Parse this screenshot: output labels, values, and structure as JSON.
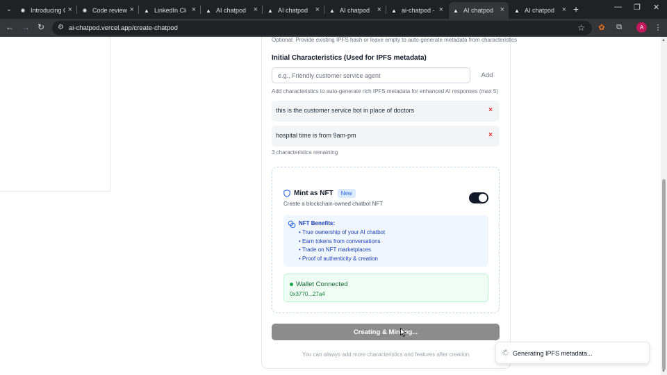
{
  "browser": {
    "tabs": [
      {
        "title": "Introducing C",
        "icon": "openai-icon"
      },
      {
        "title": "Code review",
        "icon": "openai-icon"
      },
      {
        "title": "LinkedIn Clon",
        "icon": "vercel-icon"
      },
      {
        "title": "AI chatpod",
        "icon": "vercel-icon"
      },
      {
        "title": "AI chatpod",
        "icon": "vercel-icon"
      },
      {
        "title": "AI chatpod",
        "icon": "vercel-icon"
      },
      {
        "title": "ai-chatpod -",
        "icon": "vercel-icon"
      },
      {
        "title": "AI chatpod",
        "icon": "vercel-icon",
        "active": true
      },
      {
        "title": "AI chatpod",
        "icon": "vercel-icon"
      }
    ],
    "url": "ai-chatpod.vercel.app/create-chatpod",
    "profile_initial": "A"
  },
  "form": {
    "ipfs_hint": "Optional: Provide existing IPFS hash or leave empty to auto-generate metadata from characteristics",
    "characteristics_title": "Initial Characteristics (Used for IPFS metadata)",
    "characteristic_placeholder": "e.g., Friendly customer service agent",
    "add_label": "Add",
    "characteristics_hint": "Add characteristics to auto-generate rich IPFS metadata for enhanced AI responses (max 5)",
    "characteristics": [
      "this is the customer service bot in place of doctors",
      "hospital time is from 9am-pm"
    ],
    "remove_symbol": "×",
    "remaining_text": "3 characteristics remaining"
  },
  "nft": {
    "title": "Mint as NFT",
    "badge": "New",
    "subtitle": "Create a blockchain-owned chatbot NFT",
    "toggle_on": true,
    "benefits_title": "NFT Benefits:",
    "benefits": [
      "• True ownership of your AI chatbot",
      "• Earn tokens from conversations",
      "• Trade on NFT marketplaces",
      "• Proof of authenticity & creation"
    ],
    "wallet_status": "Wallet Connected",
    "wallet_address": "0x3770...27a4"
  },
  "submit_label": "Creating & Minting...",
  "footer_note": "You can always add more characteristics and features after creation",
  "toast": {
    "message": "Generating IPFS metadata..."
  },
  "colors": {
    "accent_blue": "#2563eb",
    "wallet_green": "#16a34a",
    "remove_red": "#dc2626",
    "button_disabled": "#8c8c8c"
  }
}
